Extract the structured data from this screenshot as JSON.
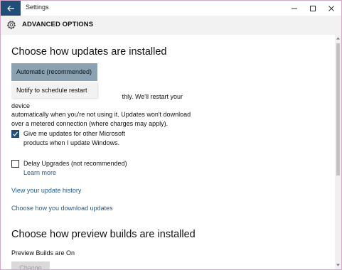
{
  "window": {
    "title": "Settings",
    "controls": {
      "minimize": "minimize-icon",
      "maximize": "maximize-icon",
      "close": "close-icon"
    }
  },
  "header": {
    "icon": "gear-icon",
    "title": "ADVANCED OPTIONS"
  },
  "updates": {
    "heading": "Choose how updates are installed",
    "dropdown": {
      "selected": "Automatic (recommended)",
      "options": [
        "Automatic (recommended)",
        "Notify to schedule restart"
      ],
      "open_option": "Notify to schedule restart"
    },
    "description_visible_tail": "thly. We'll restart your device",
    "description_line2": "automatically when you're not using it. Updates won't download",
    "description_line3": "over a metered connection (where charges may apply).",
    "other_products": {
      "label": "Give me updates for other Microsoft products when I update Windows.",
      "checked": true
    },
    "delay_upgrades": {
      "label": "Delay Upgrades (not recommended)",
      "checked": false,
      "learn_more": "Learn more"
    },
    "links": {
      "history": "View your update history",
      "download": "Choose how you download updates"
    }
  },
  "preview": {
    "heading": "Choose how preview builds are installed",
    "status": "Preview Builds are On",
    "change_button": "Change"
  },
  "colors": {
    "accent": "#1f4e79",
    "dropdown_selected_bg": "#8aa2b1",
    "link": "#1f5a8f"
  }
}
